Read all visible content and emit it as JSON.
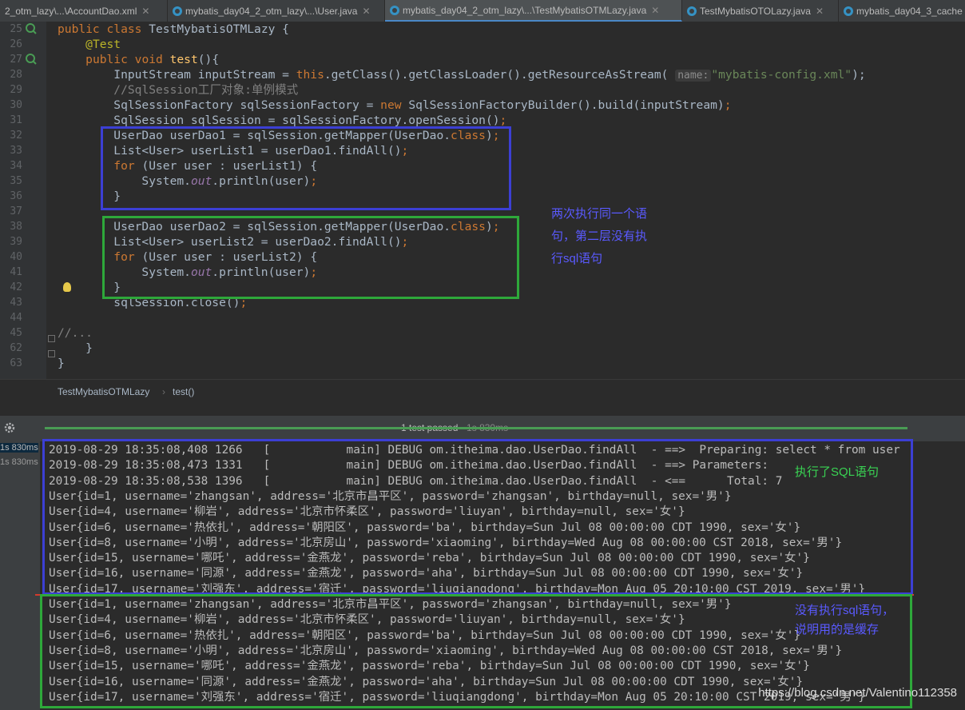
{
  "tabs": [
    {
      "label": "2_otm_lazy\\...\\AccountDao.xml"
    },
    {
      "label": "mybatis_day04_2_otm_lazy\\...\\User.java"
    },
    {
      "label": "mybatis_day04_2_otm_lazy\\...\\TestMybatisOTMLazy.java"
    },
    {
      "label": "TestMybatisOTOLazy.java"
    },
    {
      "label": "mybatis_day04_3_cache"
    }
  ],
  "editor": {
    "line_numbers": [
      "25",
      "26",
      "27",
      "28",
      "29",
      "30",
      "31",
      "32",
      "33",
      "34",
      "35",
      "36",
      "37",
      "38",
      "39",
      "40",
      "41",
      "42",
      "43",
      "44",
      "45",
      "62",
      "63"
    ],
    "fold_placeholder": "//...",
    "hint_name": "name:",
    "config_string": "\"mybatis-config.xml\"",
    "comment_factory": "//SqlSession工厂对象:单例模式"
  },
  "annotations": {
    "editor_note": [
      "两次执行同一个语",
      "句，第二层没有执",
      "行sql语句"
    ],
    "console_note_1": "执行了SQL语句",
    "console_note_2": [
      "没有执行sql语句，",
      "说明用的是缓存"
    ]
  },
  "breadcrumb": {
    "class_name": "TestMybatisOTMLazy",
    "method_name": "test()"
  },
  "run": {
    "status": "1 test passed",
    "duration": " - 1s 830ms",
    "times": [
      "1s 830ms",
      "1s 830ms"
    ]
  },
  "console": {
    "lines": [
      "2019-08-29 18:35:08,408 1266   [           main] DEBUG om.itheima.dao.UserDao.findAll  - ==>  Preparing: select * from user",
      "2019-08-29 18:35:08,473 1331   [           main] DEBUG om.itheima.dao.UserDao.findAll  - ==> Parameters: ",
      "2019-08-29 18:35:08,538 1396   [           main] DEBUG om.itheima.dao.UserDao.findAll  - <==      Total: 7",
      "User{id=1, username='zhangsan', address='北京市昌平区', password='zhangsan', birthday=null, sex='男'}",
      "User{id=4, username='柳岩', address='北京市怀柔区', password='liuyan', birthday=null, sex='女'}",
      "User{id=6, username='热依扎', address='朝阳区', password='ba', birthday=Sun Jul 08 00:00:00 CDT 1990, sex='女'}",
      "User{id=8, username='小明', address='北京房山', password='xiaoming', birthday=Wed Aug 08 00:00:00 CST 2018, sex='男'}",
      "User{id=15, username='哪吒', address='金燕龙', password='reba', birthday=Sun Jul 08 00:00:00 CDT 1990, sex='女'}",
      "User{id=16, username='同源', address='金燕龙', password='aha', birthday=Sun Jul 08 00:00:00 CDT 1990, sex='女'}",
      "User{id=17, username='刘强东', address='宿迁', password='liuqiangdong', birthday=Mon Aug 05 20:10:00 CST 2019, sex='男'}",
      "User{id=1, username='zhangsan', address='北京市昌平区', password='zhangsan', birthday=null, sex='男'}",
      "User{id=4, username='柳岩', address='北京市怀柔区', password='liuyan', birthday=null, sex='女'}",
      "User{id=6, username='热依扎', address='朝阳区', password='ba', birthday=Sun Jul 08 00:00:00 CDT 1990, sex='女'}",
      "User{id=8, username='小明', address='北京房山', password='xiaoming', birthday=Wed Aug 08 00:00:00 CST 2018, sex='男'}",
      "User{id=15, username='哪吒', address='金燕龙', password='reba', birthday=Sun Jul 08 00:00:00 CDT 1990, sex='女'}",
      "User{id=16, username='同源', address='金燕龙', password='aha', birthday=Sun Jul 08 00:00:00 CDT 1990, sex='女'}",
      "User{id=17, username='刘强东', address='宿迁', password='liuqiangdong', birthday=Mon Aug 05 20:10:00 CST 2019, sex='男'}"
    ]
  },
  "watermark": "https://blog.csdn.net/Valentino112358",
  "colors": {
    "blue_box": "#3c3fd4",
    "green_box": "#2ea83a",
    "note_blue": "#5a5aff",
    "note_green": "#39d353"
  }
}
